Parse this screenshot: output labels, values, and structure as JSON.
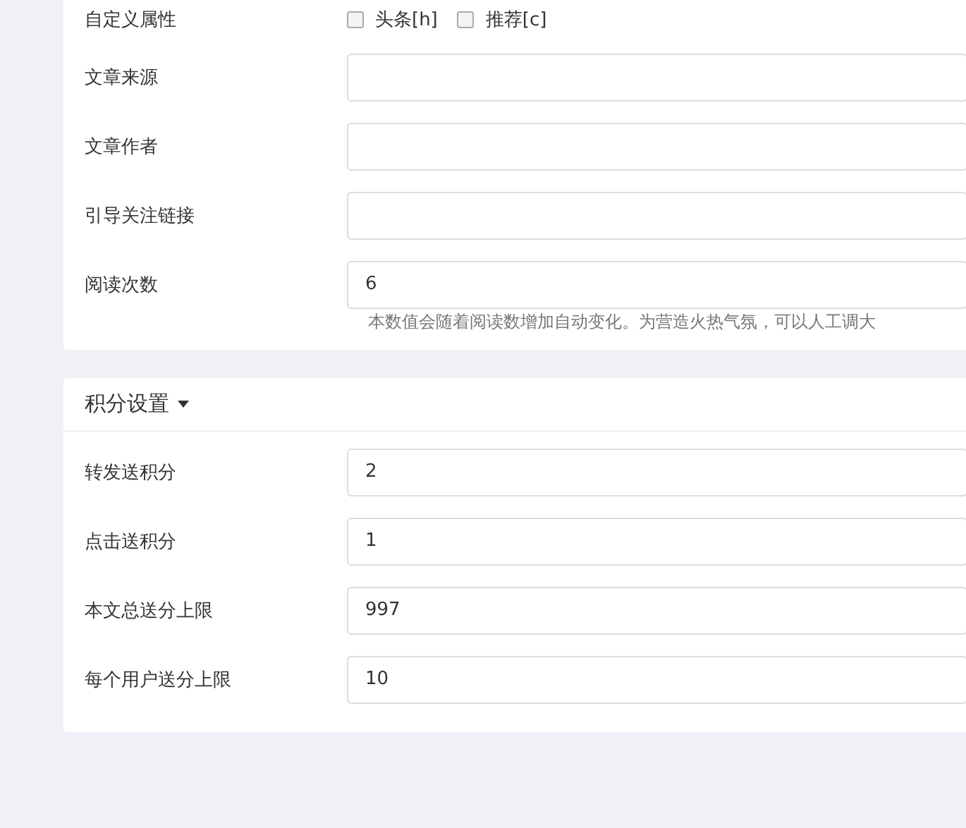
{
  "basic": {
    "attributes": {
      "label": "自定义属性",
      "options": [
        {
          "label": "头条[h]",
          "checked": false
        },
        {
          "label": "推荐[c]",
          "checked": false
        }
      ]
    },
    "fields": [
      {
        "label": "文章来源"
      },
      {
        "label": "文章作者"
      },
      {
        "label": "引导关注链接"
      },
      {
        "label": "阅读次数",
        "value": "6",
        "help": "本数值会随着阅读数增加自动变化。为营造火热气氛，可以人工调大"
      }
    ]
  },
  "points": {
    "title": "积分设置",
    "expanded": true,
    "fields": [
      {
        "label": "转发送积分",
        "value": "2"
      },
      {
        "label": "点击送积分",
        "value": "1"
      },
      {
        "label": "本文总送分上限",
        "value": "997"
      },
      {
        "label": "每个用户送分上限",
        "value": "10"
      }
    ]
  }
}
